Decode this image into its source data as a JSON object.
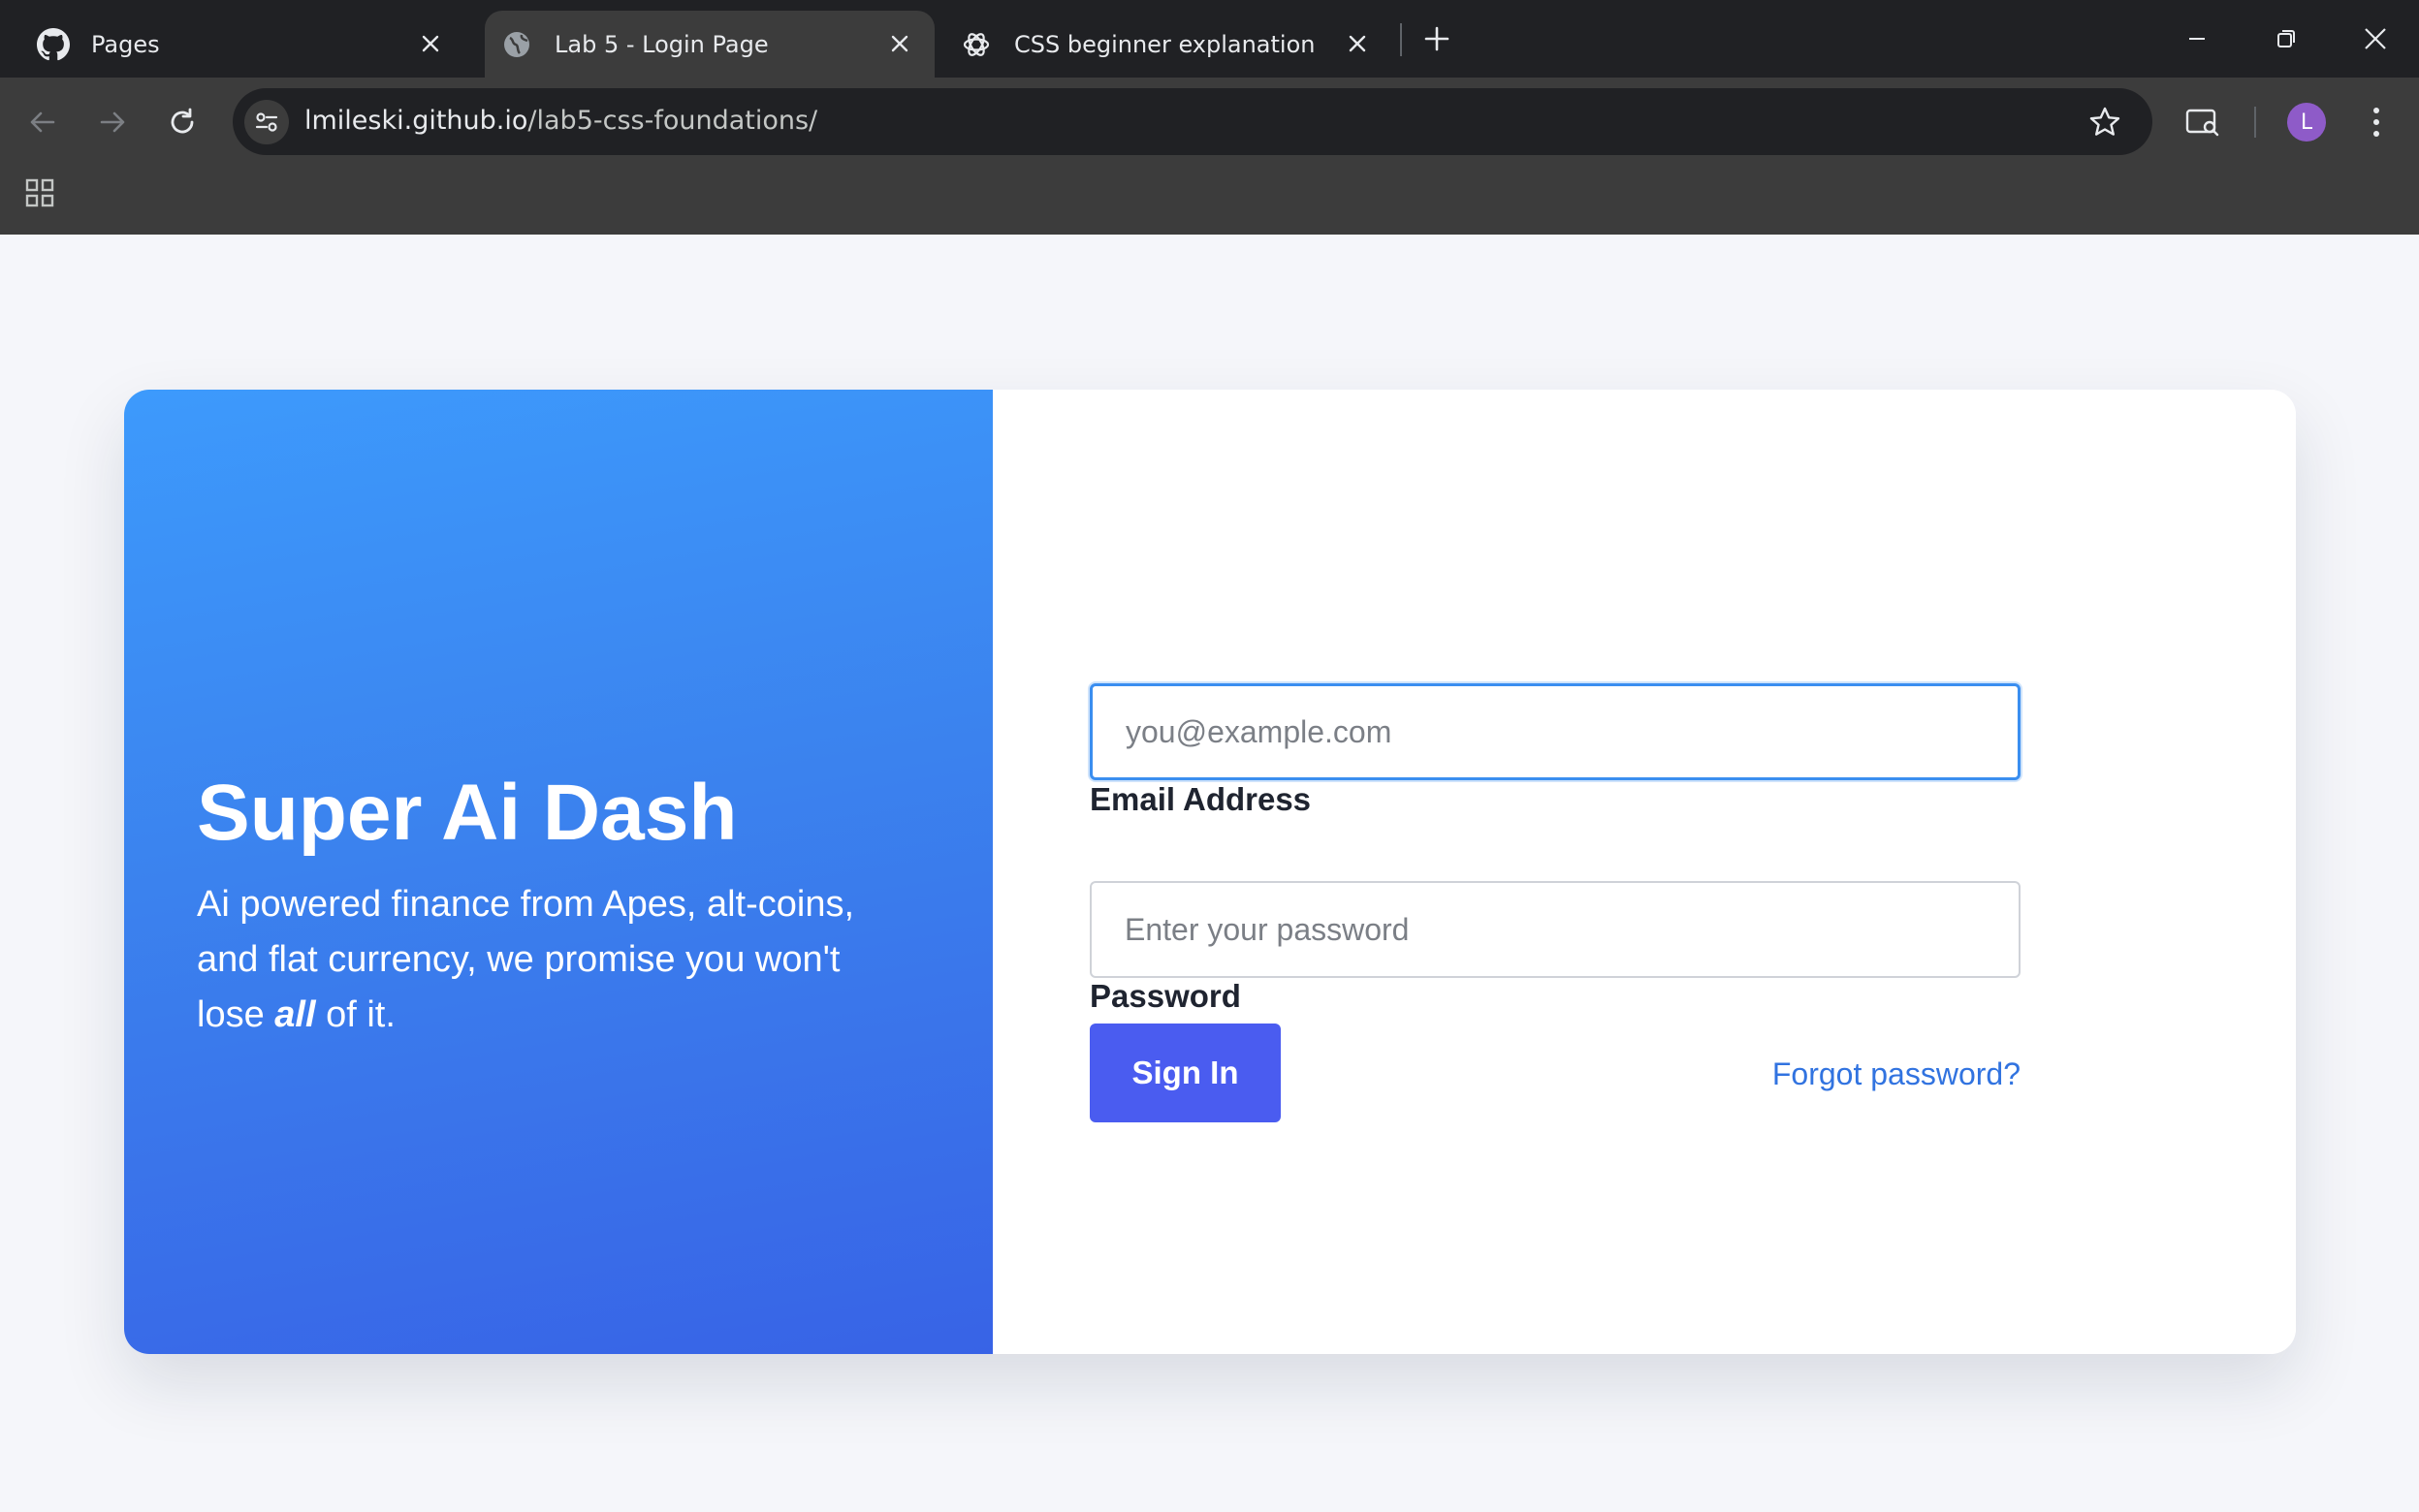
{
  "browser": {
    "tabs": [
      {
        "title": "Pages",
        "icon": "github-icon"
      },
      {
        "title": "Lab 5 - Login Page",
        "icon": "globe-icon",
        "active": true
      },
      {
        "title": "CSS beginner explanation",
        "icon": "chatgpt-icon"
      }
    ],
    "url_host": "lmileski.github.io",
    "url_path": "/lab5-css-foundations/",
    "profile_initial": "L",
    "colors": {
      "tabstrip": "#202124",
      "toolbar": "#3c3c3c",
      "avatar": "#8e5bc8"
    }
  },
  "hero": {
    "title": "Super Ai Dash",
    "text_before": "Ai powered finance from Apes, alt-coins, and flat currency, we promise you won't lose ",
    "text_emphasis": "all",
    "text_after": " of it.",
    "gradient": [
      "#3d9afc",
      "#3863e6"
    ]
  },
  "form": {
    "email_label": "Email Address",
    "email_placeholder": "you@example.com",
    "email_value": "",
    "password_label": "Password",
    "password_placeholder": "Enter your password",
    "password_value": "",
    "signin_label": "Sign In",
    "forgot_label": "Forgot password?",
    "colors": {
      "button": "#4a5cf0",
      "link": "#3173e0",
      "focus_ring": "#3a8ef0"
    }
  }
}
